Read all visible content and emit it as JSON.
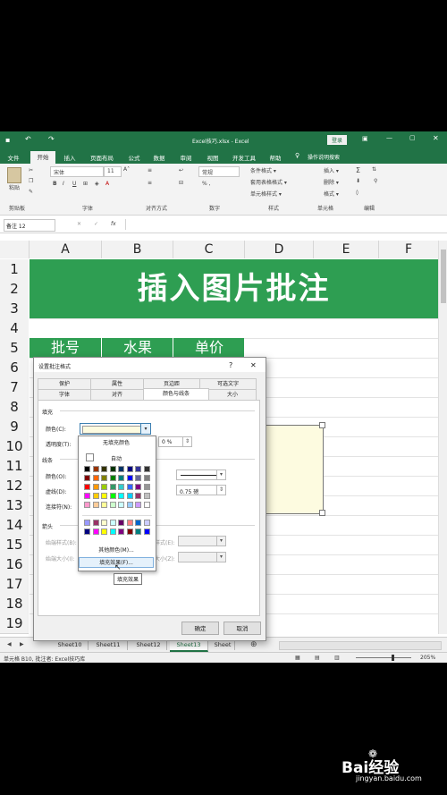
{
  "title_bar": {
    "doc_title": "Excel技巧.xlsx - Excel",
    "login_label": "登录"
  },
  "ribbon": {
    "tabs": [
      "文件",
      "开始",
      "插入",
      "页面布局",
      "公式",
      "数据",
      "审阅",
      "视图",
      "开发工具",
      "帮助"
    ],
    "active_tab": "开始",
    "tell_me": "操作说明搜索",
    "groups": [
      "剪贴板",
      "字体",
      "对齐方式",
      "数字",
      "样式",
      "单元格",
      "编辑"
    ],
    "font_name": "宋体",
    "font_size": "11",
    "number_format": "常规",
    "styles": [
      "条件格式 ▾",
      "套用表格格式 ▾",
      "单元格样式 ▾"
    ],
    "cells": [
      "插入 ▾",
      "删除 ▾",
      "格式 ▾"
    ],
    "bold": "B",
    "italic": "I",
    "underline": "U",
    "paste_label": "粘贴"
  },
  "formula_bar": {
    "name_box": "备注 12",
    "fx": "fx",
    "cancel": "✕",
    "enter": "✓"
  },
  "sheet": {
    "columns": [
      "A",
      "B",
      "C",
      "D",
      "E",
      "F"
    ],
    "rows": [
      "1",
      "2",
      "3",
      "4",
      "5",
      "6",
      "7",
      "8",
      "9",
      "10",
      "11",
      "12",
      "13",
      "14",
      "15",
      "16",
      "17",
      "18",
      "19"
    ],
    "banner_title": "插入图片批注",
    "headers": [
      "批号",
      "水果",
      "单价"
    ],
    "banner_color": "#2e9e52",
    "comment_fill": "#fdfbe0"
  },
  "dialog": {
    "title": "设置批注格式",
    "help": "?",
    "close": "✕",
    "tabs_row1": [
      "保护",
      "属性",
      "页边距",
      "可选文字"
    ],
    "tabs_row2": [
      "字体",
      "对齐",
      "颜色与线条",
      "大小"
    ],
    "active_tab": "颜色与线条",
    "fill_section": "填充",
    "color_label": "颜色(C):",
    "transparency_label": "透明度(T):",
    "transparency_value": "0 %",
    "line_section": "线条",
    "line_color_label": "颜色(O):",
    "dash_label": "虚线(D):",
    "connector_label": "连接符(N):",
    "weight_value": "0.75 磅",
    "arrow_section": "箭头",
    "begin_style": "始端样式(B):",
    "begin_size": "始端大小(I):",
    "end_style": "末端样式(E):",
    "end_size": "末端大小(Z):",
    "ok": "确定",
    "cancel": "取消"
  },
  "color_dropdown": {
    "no_fill": "无填充颜色",
    "automatic": "自动",
    "more_colors": "其他颜色(M)...",
    "fill_effects": "填充效果(F)...",
    "tooltip": "填充效果",
    "palette": [
      [
        "#000000",
        "#993300",
        "#333300",
        "#003300",
        "#003366",
        "#000080",
        "#333399",
        "#333333"
      ],
      [
        "#800000",
        "#ff6600",
        "#808000",
        "#008000",
        "#008080",
        "#0000ff",
        "#666699",
        "#808080"
      ],
      [
        "#ff0000",
        "#ff9900",
        "#99cc00",
        "#339966",
        "#33cccc",
        "#3366ff",
        "#800080",
        "#969696"
      ],
      [
        "#ff00ff",
        "#ffcc00",
        "#ffff00",
        "#00ff00",
        "#00ffff",
        "#00ccff",
        "#993366",
        "#c0c0c0"
      ],
      [
        "#ff99cc",
        "#ffcc99",
        "#ffff99",
        "#ccffcc",
        "#ccffff",
        "#99ccff",
        "#cc99ff",
        "#ffffff"
      ]
    ],
    "palette2": [
      [
        "#9999ff",
        "#993366",
        "#ffffcc",
        "#ccffff",
        "#660066",
        "#ff8080",
        "#0066cc",
        "#ccccff"
      ],
      [
        "#000080",
        "#ff00ff",
        "#ffff00",
        "#00ffff",
        "#800080",
        "#800000",
        "#008080",
        "#0000ff"
      ]
    ]
  },
  "sheet_tabs": [
    "Sheet10",
    "Sheet11",
    "Sheet12",
    "Sheet13",
    "Sheet"
  ],
  "active_sheet": "Sheet13",
  "status_bar": {
    "left": "单元格 B10, 批注者: Excel技巧库",
    "zoom": "205%"
  },
  "watermark": {
    "brand": "Bai经验",
    "url": "jingyan.baidu.com"
  }
}
